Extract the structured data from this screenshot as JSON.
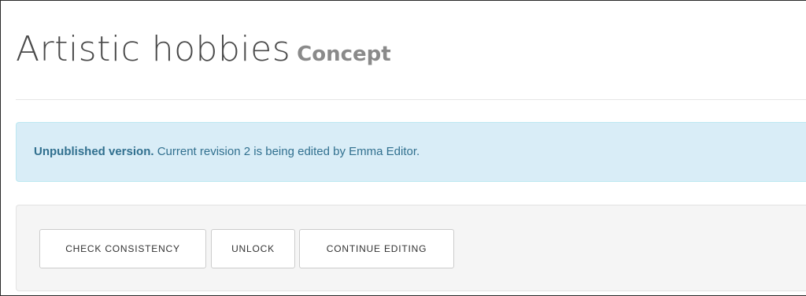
{
  "header": {
    "title": "Artistic hobbies",
    "subtitle": "Concept"
  },
  "alert": {
    "strong_text": "Unpublished version.",
    "message": " Current revision 2 is being edited by Emma Editor."
  },
  "toolbar": {
    "check_label": "CHECK CONSISTENCY",
    "unlock_label": "UNLOCK",
    "continue_label": "CONTINUE EDITING"
  },
  "colors": {
    "alert_background": "#d9edf7",
    "alert_text": "#31708f",
    "toolbar_background": "#f5f5f5"
  }
}
